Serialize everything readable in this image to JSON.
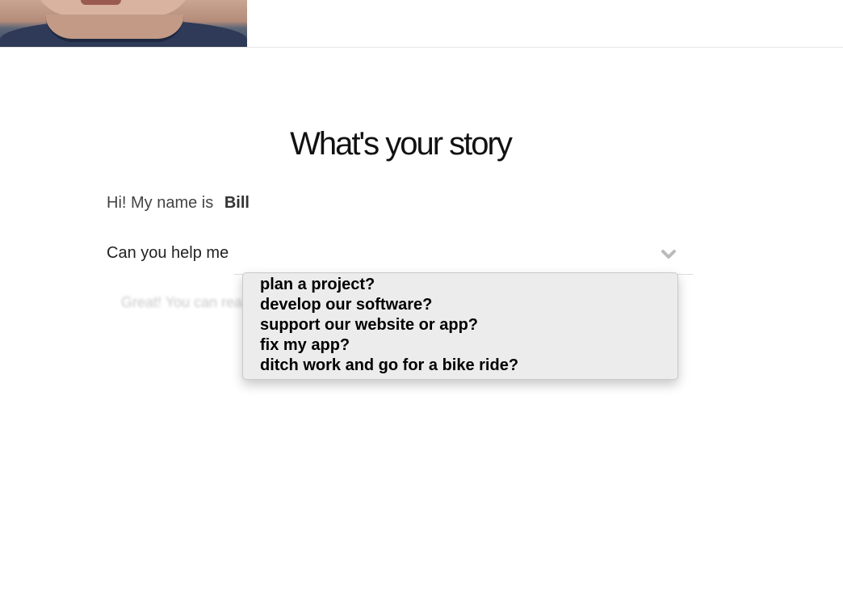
{
  "header": {
    "photo_alt": ""
  },
  "main": {
    "title": "What's your story"
  },
  "form": {
    "name_prefix": "Hi! My name is",
    "name_value": "Bill",
    "help_label": "Can you help me",
    "followup_text": "Great! You can rea",
    "dropdown": {
      "options": [
        "plan a project?",
        "develop our software?",
        "support our website or app?",
        "fix my app?",
        "ditch work and go for a bike ride?"
      ]
    }
  },
  "colors": {
    "dropdown_bg": "#ececec",
    "chevron": "#bbbbbb"
  },
  "icons": {
    "select_arrow": "chevron-down-icon"
  }
}
